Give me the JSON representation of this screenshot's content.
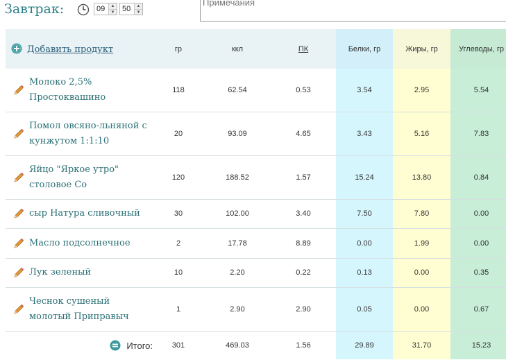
{
  "meal": {
    "title": "Завтрак:",
    "hour": "09",
    "minute": "50"
  },
  "notes": {
    "placeholder": "Примечания"
  },
  "table": {
    "add_label": "Добавить продукт",
    "headers": {
      "grams": "гр",
      "kcal": "ккл",
      "pk": "ПК",
      "protein": "Белки, гр",
      "fat": "Жиры, гр",
      "carbs": "Углеводы, гр"
    },
    "rows": [
      {
        "name": "Молоко 2,5% Простоквашино",
        "grams": "118",
        "kcal": "62.54",
        "pk": "0.53",
        "protein": "3.54",
        "fat": "2.95",
        "carbs": "5.54"
      },
      {
        "name": "Помол овсяно-льняной с кунжутом 1:1:10",
        "grams": "20",
        "kcal": "93.09",
        "pk": "4.65",
        "protein": "3.43",
        "fat": "5.16",
        "carbs": "7.83"
      },
      {
        "name": "Яйцо \"Яркое утро\" столовое Со",
        "grams": "120",
        "kcal": "188.52",
        "pk": "1.57",
        "protein": "15.24",
        "fat": "13.80",
        "carbs": "0.84"
      },
      {
        "name": "сыр Натура сливочный",
        "grams": "30",
        "kcal": "102.00",
        "pk": "3.40",
        "protein": "7.50",
        "fat": "7.80",
        "carbs": "0.00"
      },
      {
        "name": "Масло подсолнечное",
        "grams": "2",
        "kcal": "17.78",
        "pk": "8.89",
        "protein": "0.00",
        "fat": "1.99",
        "carbs": "0.00"
      },
      {
        "name": "Лук зеленый",
        "grams": "10",
        "kcal": "2.20",
        "pk": "0.22",
        "protein": "0.13",
        "fat": "0.00",
        "carbs": "0.35"
      },
      {
        "name": "Чеснок сушеный молотый Приправыч",
        "grams": "1",
        "kcal": "2.90",
        "pk": "2.90",
        "protein": "0.05",
        "fat": "0.00",
        "carbs": "0.67"
      }
    ],
    "total": {
      "label": "Итого:",
      "grams": "301",
      "kcal": "469.03",
      "pk": "1.56",
      "protein": "29.89",
      "fat": "31.70",
      "carbs": "15.23"
    }
  },
  "colors": {
    "accent": "#2a7f86",
    "protein_bg": "#d6f6fe",
    "fat_bg": "#fefed2",
    "carbs_bg": "#c8eed8"
  },
  "icons": {
    "clock": "clock-icon",
    "add": "plus-circle-icon",
    "edit": "pencil-icon",
    "total": "equals-circle-icon"
  }
}
